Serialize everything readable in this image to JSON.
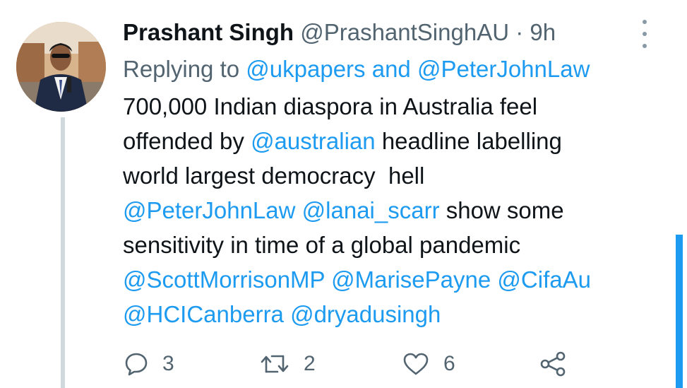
{
  "tweet": {
    "author_name": "Prashant Singh",
    "author_handle": "@PrashantSinghAU",
    "separator": "·",
    "time": "9h",
    "replying_prefix": "Replying to",
    "reply_to_1": "@ukpapers",
    "reply_and": "and",
    "reply_to_2": "@PeterJohnLaw",
    "body": {
      "l1": "700,000 Indian diaspora in Australia feel",
      "l2_a": "offended by ",
      "l2_mention": "@australian",
      "l2_b": " headline labelling",
      "l3": "world largest democracy  hell",
      "l4_m1": "@PeterJohnLaw",
      "l4_m2": "@lanai_scarr",
      "l4_b": " show some",
      "l5": "sensitivity in time of a global pandemic",
      "l6_m1": "@ScottMorrisonMP",
      "l6_m2": "@MarisePayne",
      "l6_m3": "@CifaAu",
      "l7_m1": "@HCICanberra",
      "l7_m2": "@dryadusingh"
    },
    "stats": {
      "replies": "3",
      "retweets": "2",
      "likes": "6"
    }
  },
  "icons": {
    "reply": "reply-icon",
    "retweet": "retweet-icon",
    "like": "heart-icon",
    "share": "share-icon",
    "more": "more-vertical-icon"
  },
  "colors": {
    "link": "#1d9bf0",
    "muted": "#536471",
    "text": "#0f1419",
    "thread_line": "#cfd9de",
    "scrollbar": "#1d9bf0"
  }
}
